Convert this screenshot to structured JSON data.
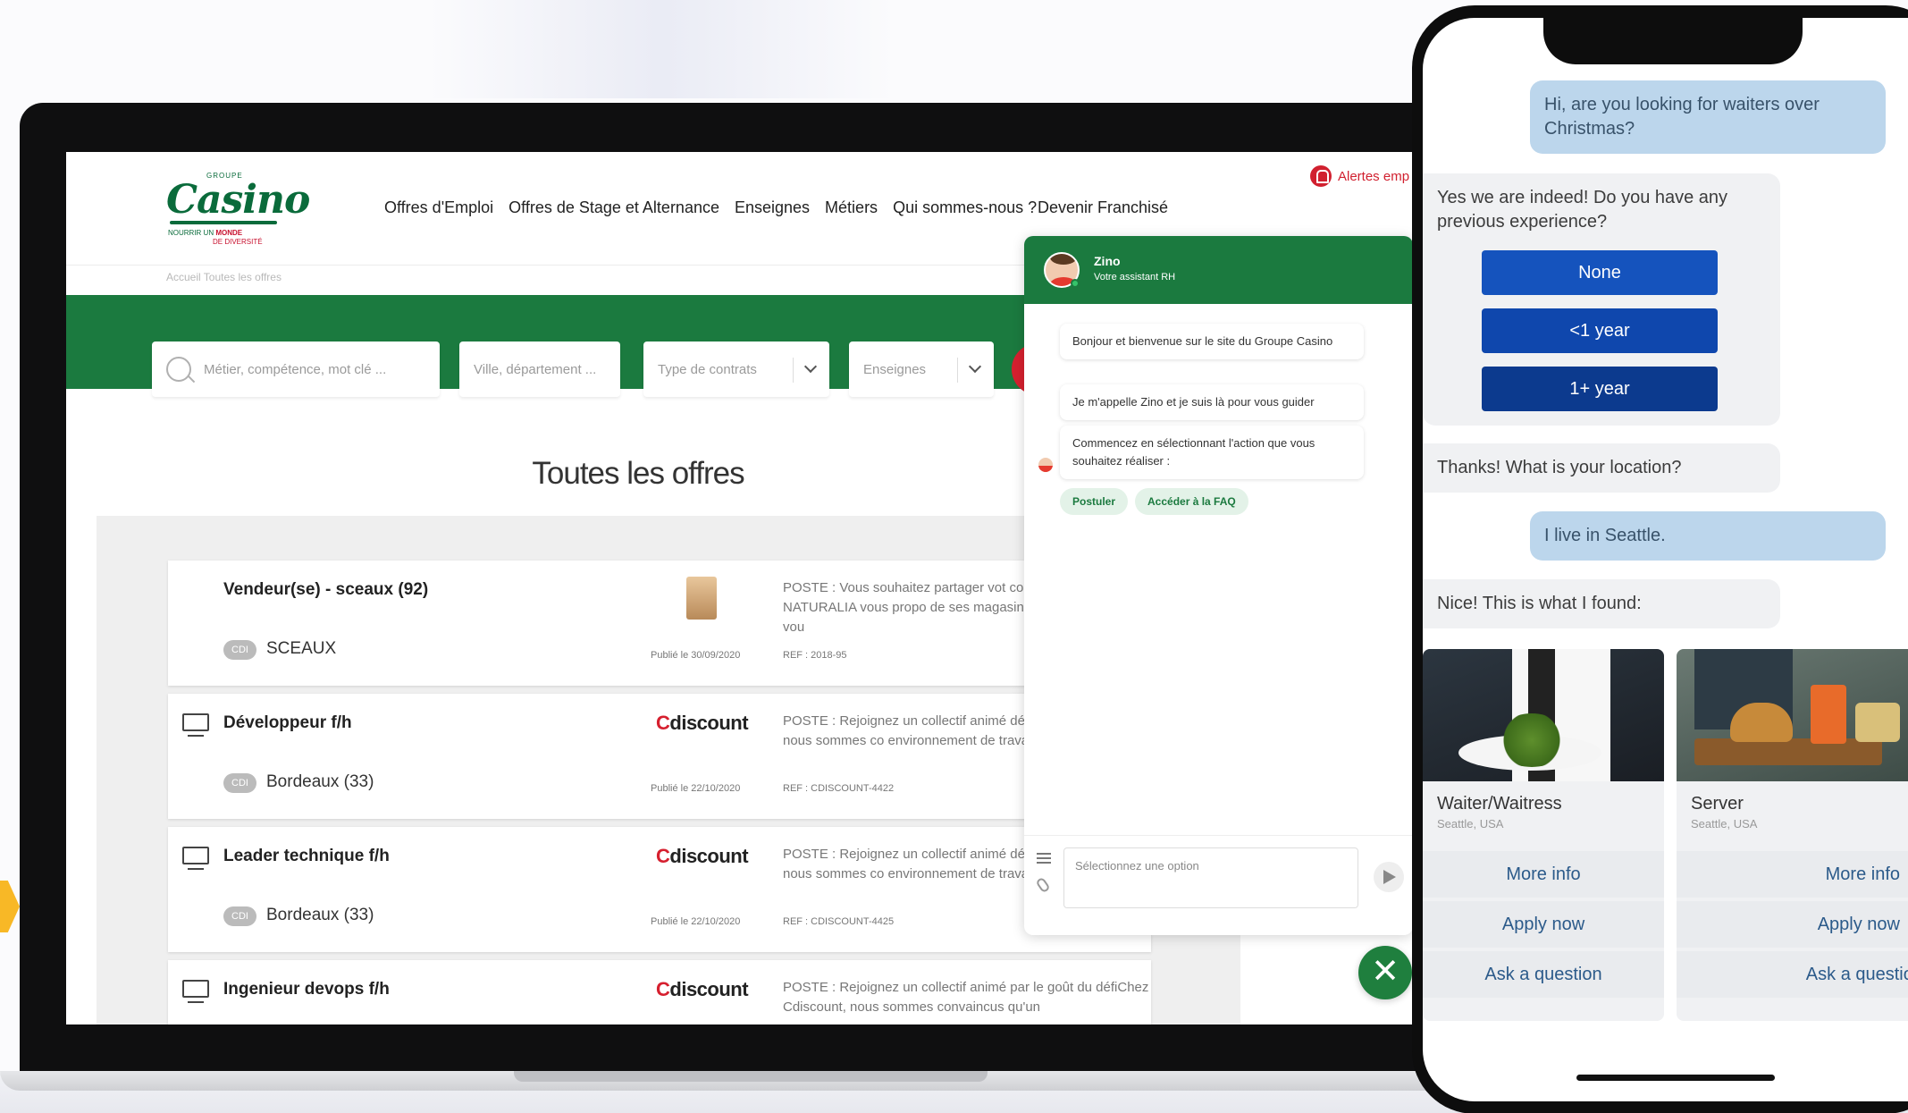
{
  "site": {
    "logo": {
      "groupe": "GROUPE",
      "word": "Casino",
      "tagline_a": "NOURRIR UN ",
      "tagline_b": "MONDE",
      "tagline_c": "DE DIVERSITÉ"
    },
    "nav": [
      "Offres d'Emploi",
      "Offres de Stage et Alternance",
      "Enseignes",
      "Métiers",
      "Qui sommes-nous ?"
    ],
    "nav_franchise": "Devenir Franchisé",
    "alert_label": "Alertes emp",
    "breadcrumb": "Accueil  Toutes les offres",
    "search": {
      "keyword_placeholder": "Métier, compétence, mot clé ...",
      "city_placeholder": "Ville, département ...",
      "contract_label": "Type de contrats",
      "brand_label": "Enseignes"
    },
    "page_title": "Toutes les offres",
    "jobs": [
      {
        "title": "Vendeur(se) - sceaux (92)",
        "contract": "CDI",
        "location": "SCEAUX",
        "brand": "",
        "published": "Publié le 30/09/2020",
        "description": "POSTE : Vous souhaitez partager vot commerce ? NATURALIA vous propo de ses magasins de proximité où vou",
        "ref": "REF : 2018-95"
      },
      {
        "title": "Développeur f/h",
        "contract": "CDI",
        "location": "Bordeaux (33)",
        "brand": "discount",
        "brand_c": "C",
        "published": "Publié le 22/10/2020",
        "description": "POSTE : Rejoignez un collectif animé défiChez Cdiscount, nous sommes co environnement de travail épanouissa",
        "ref": "REF : CDISCOUNT-4422"
      },
      {
        "title": "Leader technique f/h",
        "contract": "CDI",
        "location": "Bordeaux (33)",
        "brand": "discount",
        "brand_c": "C",
        "published": "Publié le 22/10/2020",
        "description": "POSTE : Rejoignez un collectif animé défiChez Cdiscount, nous sommes co environnement de travail épanouissa",
        "ref": "REF : CDISCOUNT-4425"
      },
      {
        "title": "Ingenieur devops f/h",
        "contract": "",
        "location": "",
        "brand": "discount",
        "brand_c": "C",
        "published": "",
        "description": "POSTE : Rejoignez un collectif animé par le goût du défiChez Cdiscount, nous sommes convaincus qu'un",
        "ref": ""
      }
    ]
  },
  "chat": {
    "name": "Zino",
    "subtitle": "Votre assistant RH",
    "messages": [
      "Bonjour et bienvenue sur le site du Groupe Casino",
      "Je m'appelle Zino et je suis là pour vous guider",
      "Commencez en sélectionnant l'action que vous souhaitez réaliser :"
    ],
    "quick_replies": [
      "Postuler",
      "Accéder à la FAQ"
    ],
    "input_placeholder": "Sélectionnez une option",
    "close_glyph": "✕"
  },
  "phone": {
    "user_msg_1": "Hi, are you looking for waiters over Christmas?",
    "bot_msg_1": "Yes we are indeed! Do you have any previous experience?",
    "options": [
      "None",
      "<1 year",
      "1+ year"
    ],
    "bot_msg_2": "Thanks! What is your location?",
    "user_msg_2": "I live in Seattle.",
    "bot_msg_3": "Nice! This is what I found:",
    "cards": [
      {
        "title": "Waiter/Waitress",
        "location": "Seattle, USA",
        "buttons": [
          "More info",
          "Apply now",
          "Ask a question"
        ]
      },
      {
        "title": "Server",
        "location": "Seattle, USA",
        "buttons": [
          "More info",
          "Apply now",
          "Ask a question"
        ]
      }
    ]
  },
  "colors": {
    "casino_green": "#1b7a3f",
    "casino_red": "#d6202f",
    "option_blue_1": "#1553bd",
    "option_blue_2": "#0f47ad",
    "option_blue_3": "#0c3a8e",
    "user_bubble": "#bcd6ec"
  },
  "icons": [
    "search-icon",
    "chevron-down-icon",
    "bell-icon",
    "monitor-icon",
    "menu-icon",
    "paperclip-icon",
    "send-icon",
    "close-icon"
  ]
}
